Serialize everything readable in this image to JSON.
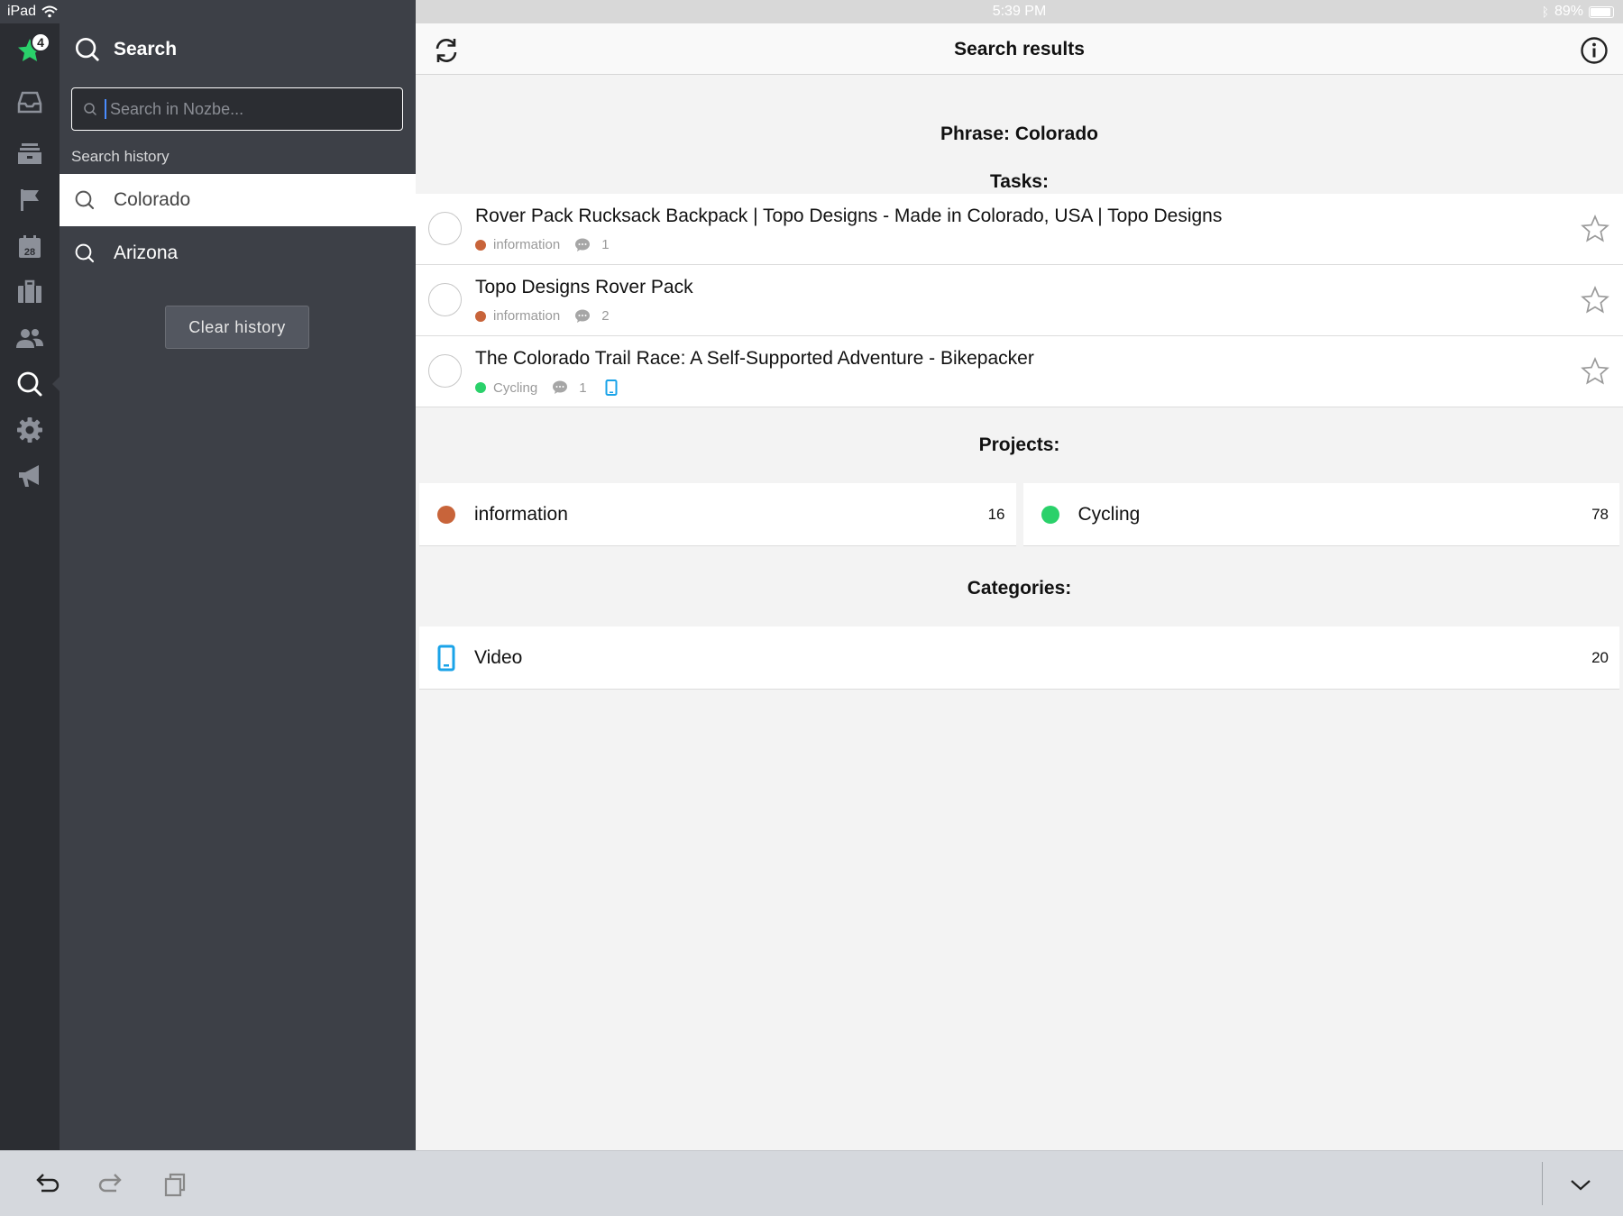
{
  "status_bar": {
    "device": "iPad",
    "time": "5:39 PM",
    "battery": "89%"
  },
  "rail": {
    "badge_count": "4",
    "items": [
      {
        "name": "priority",
        "icon": "star-icon"
      },
      {
        "name": "inbox",
        "icon": "inbox-icon"
      },
      {
        "name": "archive",
        "icon": "archive-icon"
      },
      {
        "name": "flags",
        "icon": "flag-icon"
      },
      {
        "name": "calendar",
        "icon": "calendar-icon",
        "label": "28"
      },
      {
        "name": "projects",
        "icon": "briefcase-icon"
      },
      {
        "name": "team",
        "icon": "people-icon"
      },
      {
        "name": "search",
        "icon": "search-icon"
      },
      {
        "name": "settings",
        "icon": "gear-icon"
      },
      {
        "name": "news",
        "icon": "megaphone-icon"
      }
    ]
  },
  "sidebar": {
    "title": "Search",
    "search_placeholder": "Search in Nozbe...",
    "history_label": "Search history",
    "history": [
      {
        "label": "Colorado",
        "active": true
      },
      {
        "label": "Arizona",
        "active": false
      }
    ],
    "clear_history_label": "Clear history"
  },
  "main": {
    "title": "Search results",
    "phrase": "Phrase: Colorado",
    "tasks_heading": "Tasks:",
    "tasks": [
      {
        "title": "Rover Pack Rucksack Backpack | Topo Designs - Made in Colorado, USA | Topo Designs",
        "project": "information",
        "project_color": "#c8643a",
        "comments": "1",
        "has_category": false
      },
      {
        "title": "Topo Designs Rover Pack",
        "project": "information",
        "project_color": "#c8643a",
        "comments": "2",
        "has_category": false
      },
      {
        "title": "The Colorado Trail Race: A Self-Supported Adventure - Bikepacker",
        "project": "Cycling",
        "project_color": "#2ad16a",
        "comments": "1",
        "has_category": true
      }
    ],
    "projects_heading": "Projects:",
    "projects": [
      {
        "name": "information",
        "color": "#c8643a",
        "count": "16"
      },
      {
        "name": "Cycling",
        "color": "#2ad16a",
        "count": "78"
      }
    ],
    "categories_heading": "Categories:",
    "categories": [
      {
        "name": "Video",
        "icon": "tablet-icon",
        "color": "#1aa3e8",
        "count": "20"
      }
    ]
  },
  "colors": {
    "rail_bg": "#2b2d32",
    "sidebar_bg": "#3d4047",
    "accent_green": "#2ad16a",
    "category_blue": "#1aa3e8"
  }
}
